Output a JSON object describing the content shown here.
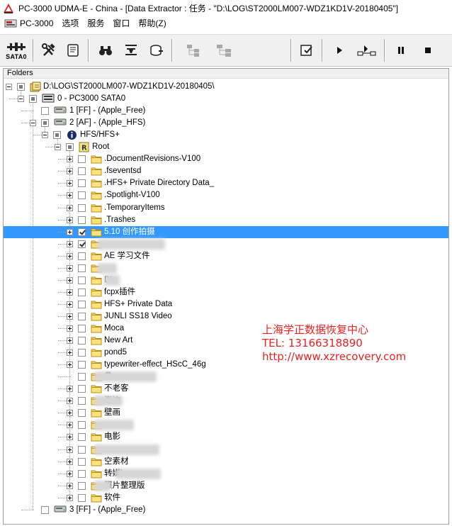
{
  "window": {
    "title": "PC-3000 UDMA-E - China - [Data Extractor : 任务 - \"D:\\LOG\\ST2000LM007-WDZ1KD1V-20180405\"]"
  },
  "menu": {
    "items": [
      "PC-3000",
      "选项",
      "服务",
      "窗口",
      "帮助(Z)"
    ]
  },
  "toolbar": {
    "sata_label": "SATA0"
  },
  "panel": {
    "header": "Folders"
  },
  "tree": {
    "root": "D:\\LOG\\ST2000LM007-WDZ1KD1V-20180405\\",
    "device": "0 - PC3000 SATA0",
    "part1": "1 [FF] - (Apple_Free)",
    "part2": "2 [AF] - (Apple_HFS)",
    "fs": "HFS/HFS+",
    "rootdir": "Root",
    "part3": "3 [FF] - (Apple_Free)",
    "folders": [
      ".DocumentRevisions-V100",
      ".fseventsd",
      ".HFS+ Private Directory Data_",
      ".Spotlight-V100",
      ".TemporaryItems",
      ".Trashes",
      "5.10 创作拍摄",
      "",
      "AE 学习文件",
      "",
      "D'",
      "fcpx插件",
      "HFS+ Private Data",
      "JUNLI SS18 Video",
      "Moca",
      "New Art",
      "pond5",
      "typewriter-effect_HScC_46g",
      "晶",
      "不老客",
      "海边",
      "壁画",
      "",
      "电影",
      "",
      "空素材",
      "转媒|",
      "照片整理版",
      "软件"
    ]
  },
  "watermark": {
    "line1": "上海学正数据恢复中心",
    "line2": "TEL: 13166318890",
    "line3": "http://www.xzrecovery.com"
  },
  "colors": {
    "selection": "#3399ff",
    "folder": "#f7d65c",
    "watermark": "#e8221f"
  }
}
